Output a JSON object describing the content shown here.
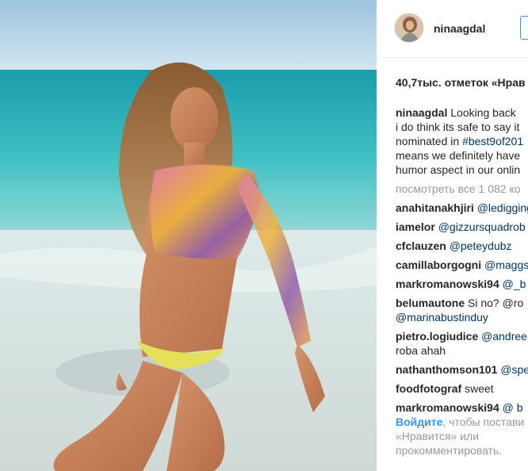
{
  "post": {
    "username": "ninaagdal",
    "likes": "40,7тыс. отметок «Нрав",
    "caption_lines": [
      "Looking back",
      "i do think its safe to say it",
      "nominated in ",
      "means we definitely have",
      "humor aspect in our onlin"
    ],
    "caption_hashtag": "#best9of201",
    "view_all": "посмотреть все 1 082 ко"
  },
  "comments": [
    {
      "user": "anahitanakhjiri",
      "text": "@ledigging"
    },
    {
      "user": "iamelor",
      "text": "@gizzursquadrob"
    },
    {
      "user": "cfclauzen",
      "text": "@peteydubz"
    },
    {
      "user": "camillaborgogni",
      "text": "@maggs"
    },
    {
      "user": "markromanowski94",
      "text": "@_b"
    },
    {
      "user": "belumautone",
      "text": "Si no? @ro",
      "cont": "@marinabustinduy"
    },
    {
      "user": "pietro.logiudice",
      "text": "@andree",
      "cont": "roba ahah"
    },
    {
      "user": "nathanthomson101",
      "text": "@spe"
    },
    {
      "user": "foodfotograf",
      "text": "sweet"
    },
    {
      "user": "markromanowski94",
      "text": "@ b"
    }
  ],
  "login_prompt": {
    "link": "Войдите",
    "text1": ", чтобы постави",
    "text2": "«Нравится» или",
    "text3": "прокомментировать."
  }
}
